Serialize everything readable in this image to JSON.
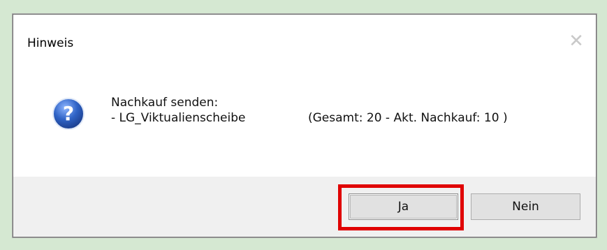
{
  "dialog": {
    "title": "Hinweis",
    "close_icon": "close-icon",
    "icon": "question-icon",
    "message_line1": "Nachkauf senden:",
    "message_line2": "- LG_Viktualienscheibe",
    "message_detail": "(Gesamt: 20 - Akt. Nachkauf: 10 )",
    "buttons": {
      "yes_label": "Ja",
      "no_label": "Nein"
    }
  },
  "colors": {
    "backdrop": "#d5e8d2",
    "highlight": "#e00000",
    "footer": "#f0f0f0",
    "icon_blue": "#2f63c6"
  }
}
